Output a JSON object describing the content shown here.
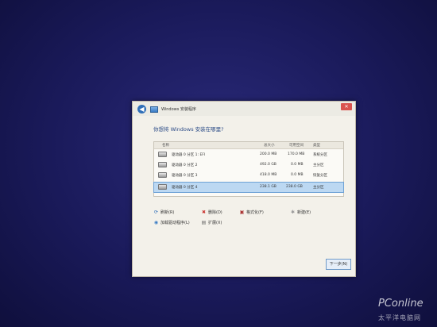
{
  "window": {
    "title": "Windows 安装程序",
    "heading": "你想将 Windows 安装在哪里?",
    "close_glyph": "✕",
    "back_glyph": "◀"
  },
  "table": {
    "headers": {
      "name": "名称",
      "total": "总大小",
      "free": "可用空间",
      "type": "类型"
    },
    "rows": [
      {
        "name": "驱动器 0 分区 1: EFI",
        "total": "200.0 MB",
        "free": "170.0 MB",
        "type": "系统分区",
        "selected": false
      },
      {
        "name": "驱动器 0 分区 2",
        "total": "492.0 GB",
        "free": "0.0 MB",
        "type": "主分区",
        "selected": false
      },
      {
        "name": "驱动器 0 分区 3",
        "total": "418.0 MB",
        "free": "0.0 MB",
        "type": "恢复分区",
        "selected": false
      },
      {
        "name": "驱动器 0 分区 4",
        "total": "238.1 GB",
        "free": "238.0 GB",
        "type": "主分区",
        "selected": true
      }
    ]
  },
  "actions": {
    "refresh": "刷新(R)",
    "delete": "删除(D)",
    "format": "格式化(F)",
    "new": "新建(E)",
    "load_driver": "加载驱动程序(L)",
    "extend": "扩展(X)"
  },
  "icons": {
    "refresh": "⟳",
    "delete": "✖",
    "format": "▣",
    "new": "✱",
    "load_driver": "◉",
    "extend": "▤"
  },
  "next_button": "下一步(N)",
  "watermark": {
    "logo": "PConline",
    "sub": "太平洋电脑网"
  },
  "colors": {
    "accent": "#2f6fb8",
    "selected_row": "#bcd8f2",
    "background": "#1a1a5a"
  }
}
